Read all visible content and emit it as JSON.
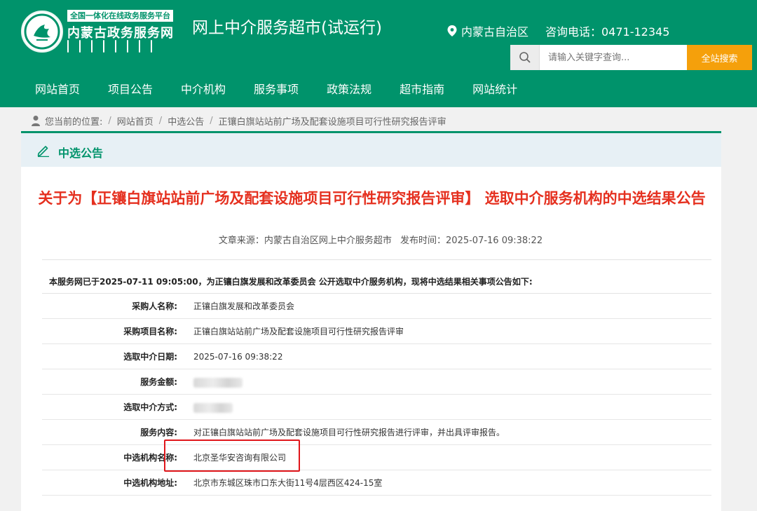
{
  "header": {
    "logo_tag": "全国一体化在线政务服务平台",
    "logo_name": "内蒙古政务服务网",
    "site_title": "网上中介服务超市(试运行)",
    "location": "内蒙古自治区",
    "phone": "咨询电话：0471-12345",
    "brand_color": "#00936b",
    "accent_color": "#f5a00b"
  },
  "search": {
    "placeholder": "请输入关键字查询...",
    "button_label": "全站搜索"
  },
  "nav": {
    "items": [
      "网站首页",
      "项目公告",
      "中介机构",
      "服务事项",
      "政策法规",
      "超市指南",
      "网站统计"
    ]
  },
  "breadcrumb": {
    "prefix": "您当前的位置:",
    "items": [
      "网站首页",
      "中选公告",
      "正镶白旗站站前广场及配套设施项目可行性研究报告评审"
    ]
  },
  "section": {
    "title": "中选公告"
  },
  "article": {
    "title": "关于为【正镶白旗站站前广场及配套设施项目可行性研究报告评审】 选取中介服务机构的中选结果公告",
    "source": "文章来源：内蒙古自治区网上中介服务超市",
    "publish_time": "发布时间：2025-07-16 09:38:22",
    "title_color": "#e5301f",
    "intro": "本服务网已于2025-07-11 09:05:00，为正镶白旗发展和改革委员会 公开选取中介服务机构，现将中选结果相关事项公告如下:",
    "rows": [
      {
        "label": "采购人名称:",
        "value": "正镶白旗发展和改革委员会"
      },
      {
        "label": "采购项目名称:",
        "value": "正镶白旗站站前广场及配套设施项目可行性研究报告评审"
      },
      {
        "label": "选取中介日期:",
        "value": "2025-07-16 09:38:22"
      },
      {
        "label": "服务金额:",
        "value": ""
      },
      {
        "label": "选取中介方式:",
        "value": ""
      },
      {
        "label": "服务内容:",
        "value": "对正镶白旗站站前广场及配套设施项目可行性研究报告进行评审，并出具评审报告。"
      },
      {
        "label": "中选机构名称:",
        "value": "北京圣华安咨询有限公司"
      },
      {
        "label": "中选机构地址:",
        "value": "北京市东城区珠市口东大街11号4层西区424-15室"
      }
    ]
  }
}
